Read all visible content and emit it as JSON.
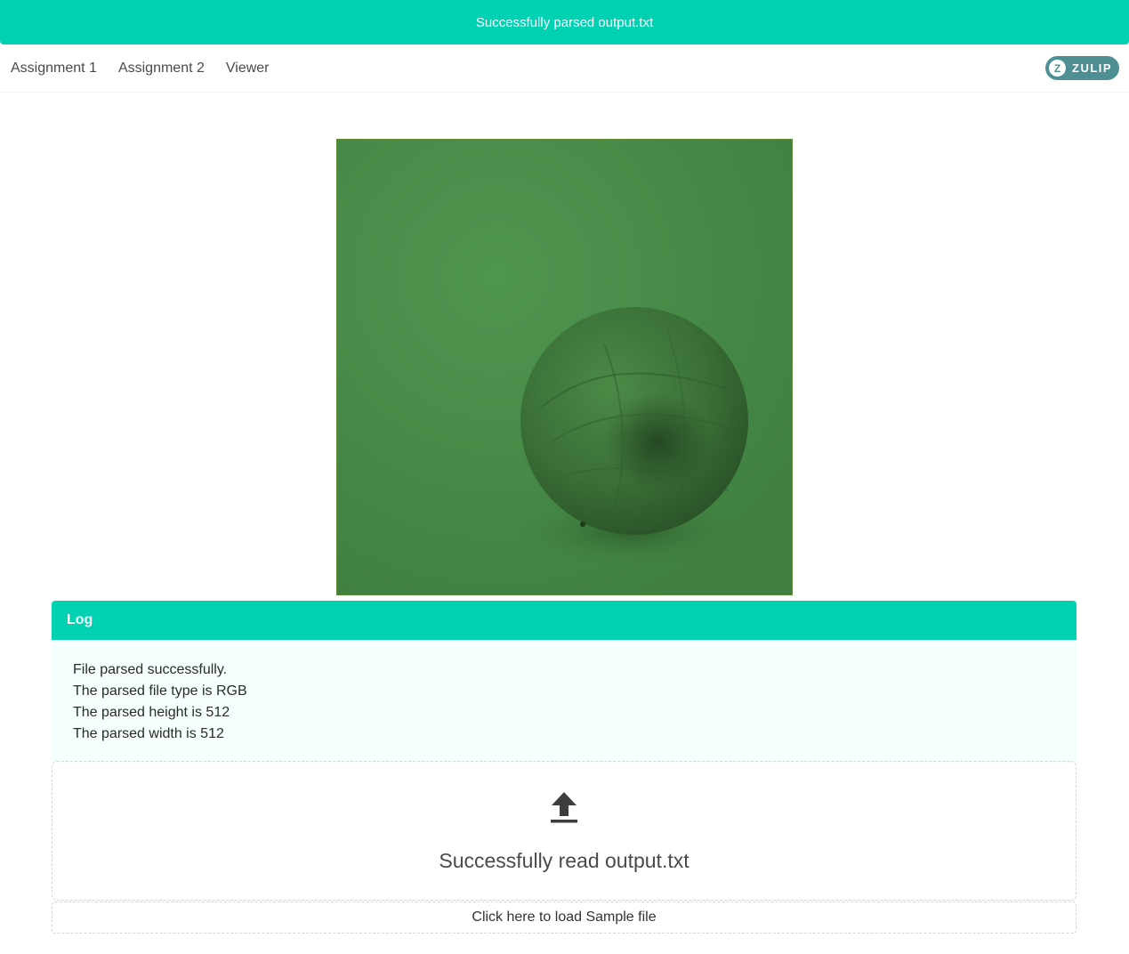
{
  "toast": {
    "message": "Successfully parsed output.txt"
  },
  "navbar": {
    "items": [
      {
        "label": "Assignment 1"
      },
      {
        "label": "Assignment 2"
      },
      {
        "label": "Viewer"
      }
    ],
    "badge": {
      "icon_letter": "Z",
      "label": "ZULIP"
    }
  },
  "viewer": {
    "image_icon": "rendered-image-green-sphere"
  },
  "log": {
    "title": "Log",
    "lines": [
      "File parsed successfully.",
      "The parsed file type is RGB",
      "The parsed height is 512",
      "The parsed width is 512"
    ]
  },
  "upload": {
    "icon": "upload-icon",
    "status": "Successfully read output.txt"
  },
  "sample": {
    "label": "Click here to load Sample file"
  },
  "colors": {
    "accent": "#00d1b2",
    "badge": "#4e8f93",
    "image_bg": "#458845"
  }
}
